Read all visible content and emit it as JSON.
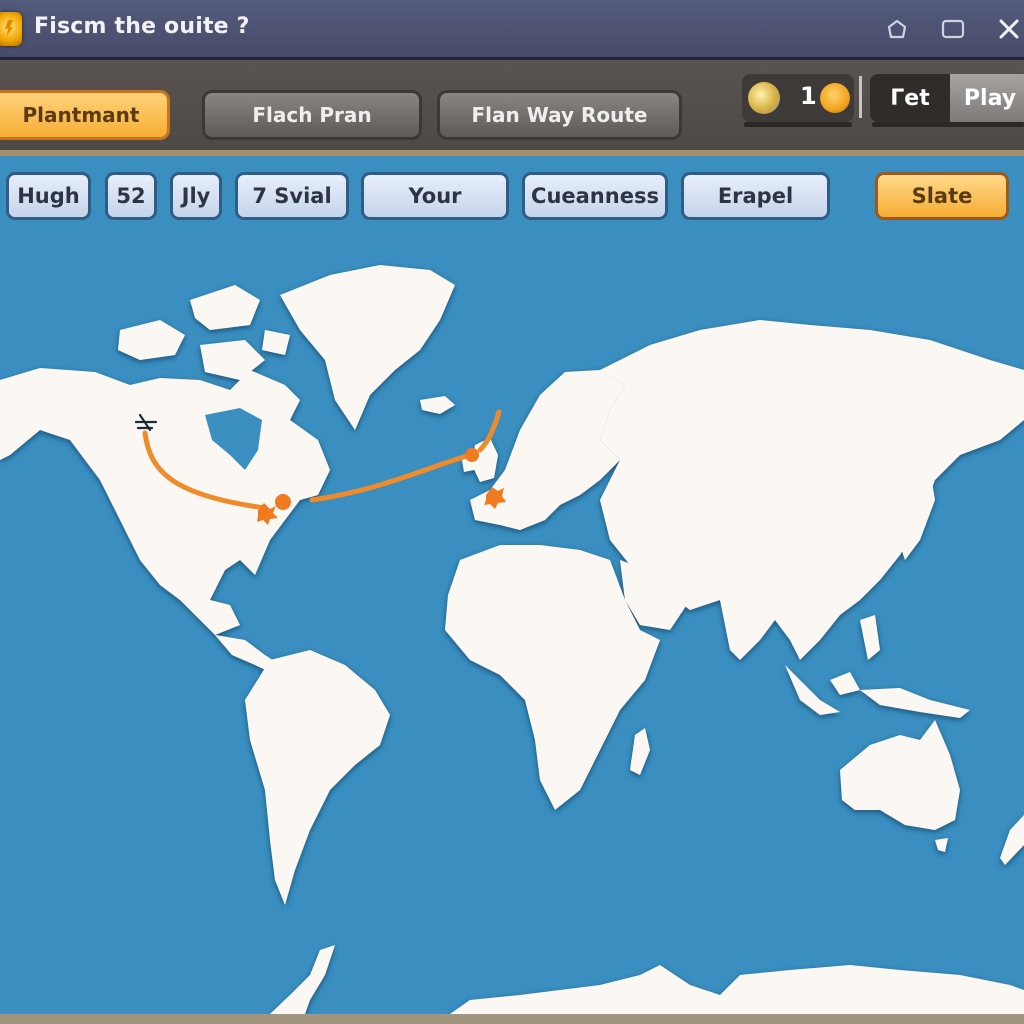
{
  "window": {
    "title": "Fiscm the ouite ?",
    "controls": [
      "minimize",
      "maximize",
      "close"
    ]
  },
  "toolbar": {
    "buttons": [
      {
        "label": "Plantmant",
        "style": "orange",
        "active": true
      },
      {
        "label": "Flach Pran",
        "style": "gray"
      },
      {
        "label": "Flan Way Route",
        "style": "gray"
      }
    ],
    "currency": {
      "count": "1",
      "icon": "coin-icon",
      "avatar_icon": "globe-icon"
    },
    "mode_toggle": {
      "options": [
        "Γet",
        "Play"
      ],
      "selected": "Play"
    }
  },
  "filters": {
    "chips": [
      {
        "label": "Hugh"
      },
      {
        "label": "52"
      },
      {
        "label": "Jly"
      },
      {
        "label": "7 Svial"
      },
      {
        "label": "Your"
      },
      {
        "label": "Cueanness"
      },
      {
        "label": "Erapel"
      },
      {
        "label": "Slate",
        "active": true
      }
    ]
  },
  "map": {
    "ocean_color": "#3a8fc0",
    "land_color": "#fbf8f3",
    "route_color": "#f08a2a",
    "route": {
      "origin": "Western Canada",
      "waypoints": [
        "Great Lakes",
        "Newfoundland",
        "British Isles",
        "France"
      ],
      "stops": [
        {
          "name": "Great Lakes",
          "marker": "burst"
        },
        {
          "name": "Quebec",
          "marker": "dot"
        },
        {
          "name": "Ireland",
          "marker": "dot"
        },
        {
          "name": "France",
          "marker": "burst"
        }
      ]
    }
  },
  "colors": {
    "titlebar": "#4d5272",
    "toolbar": "#524d49",
    "accent_orange": "#f6ae36",
    "chip_bg": "#d6e1f3"
  }
}
